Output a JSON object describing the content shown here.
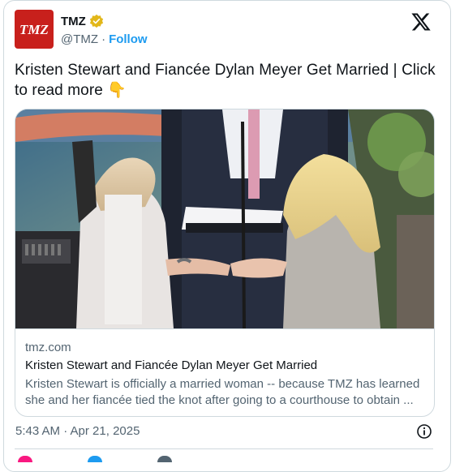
{
  "account": {
    "logo_text": "TMZ",
    "name": "TMZ",
    "handle": "@TMZ",
    "separator": "·",
    "follow_label": "Follow"
  },
  "tweet": {
    "text": "Kristen Stewart and Fiancée Dylan Meyer Get Married  |  Click to read more 👇"
  },
  "link_card": {
    "domain": "tmz.com",
    "title": "Kristen Stewart and Fiancée Dylan Meyer Get Married",
    "description": "Kristen Stewart is officially a married woman -- because TMZ has learned she and her fiancée tied the knot after going to a courthouse to obtain ..."
  },
  "meta": {
    "timestamp": "5:43 AM · Apr 21, 2025"
  },
  "icons": {
    "verified": "gold-verified-badge-icon",
    "x_logo": "x-logo-icon",
    "info": "info-icon",
    "like": "heart-icon",
    "reply": "reply-icon",
    "share": "share-icon"
  },
  "colors": {
    "brand_red": "#c8201c",
    "follow_blue": "#1d9bf0",
    "verified_gold": "#e2b719",
    "secondary_text": "#536471"
  }
}
